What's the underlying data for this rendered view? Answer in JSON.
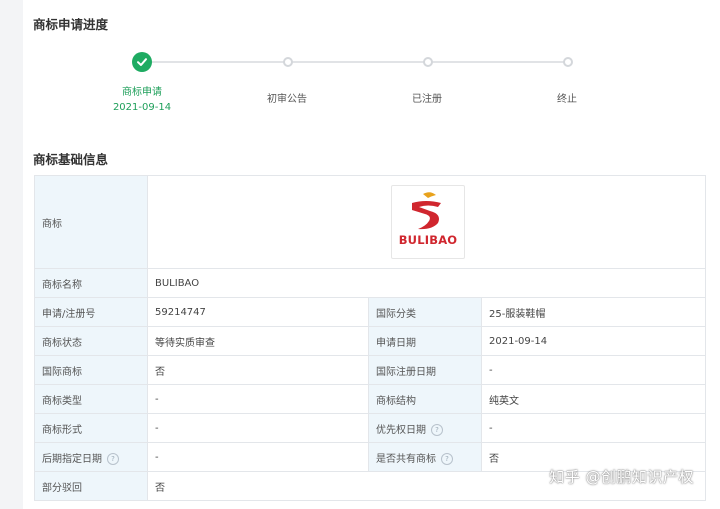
{
  "progress": {
    "title": "商标申请进度",
    "steps": [
      {
        "label": "商标申请",
        "date": "2021-09-14",
        "status": "done"
      },
      {
        "label": "初审公告",
        "status": "pending"
      },
      {
        "label": "已注册",
        "status": "pending"
      },
      {
        "label": "终止",
        "status": "pending"
      }
    ]
  },
  "basic": {
    "title": "商标基础信息",
    "logo_label": "商标",
    "logo_text": "BULIBAO",
    "rows": [
      {
        "k1": "商标名称",
        "v1": "BULIBAO"
      },
      {
        "k1": "申请/注册号",
        "v1": "59214747",
        "k2": "国际分类",
        "v2": "25-服装鞋帽"
      },
      {
        "k1": "商标状态",
        "v1": "等待实质审查",
        "k2": "申请日期",
        "v2": "2021-09-14"
      },
      {
        "k1": "国际商标",
        "v1": "否",
        "k2": "国际注册日期",
        "v2": "-"
      },
      {
        "k1": "商标类型",
        "v1": "-",
        "k2": "商标结构",
        "v2": "纯英文"
      },
      {
        "k1": "商标形式",
        "v1": "-",
        "k2": "优先权日期",
        "v2": "-"
      },
      {
        "k1": "后期指定日期",
        "v1": "-",
        "k2": "是否共有商标",
        "v2": "否"
      },
      {
        "k1": "部分驳回",
        "v1": "否"
      }
    ]
  },
  "help_icon_glyph": "?",
  "watermark": "知乎 @创鹏知识产权",
  "colors": {
    "accent_green": "#1eab62",
    "logo_red": "#d0262e",
    "key_cell_bg": "#eef6fb"
  }
}
